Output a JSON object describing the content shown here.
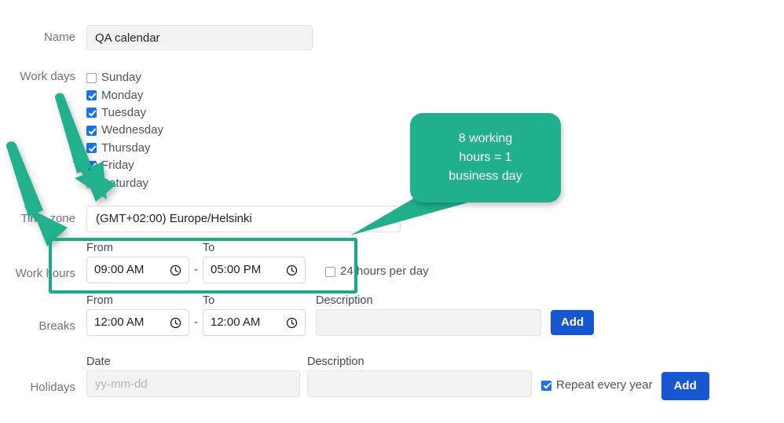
{
  "form": {
    "name": {
      "label": "Name",
      "value": "QA calendar"
    },
    "work_days": {
      "label": "Work days",
      "days": [
        {
          "label": "Sunday",
          "checked": false
        },
        {
          "label": "Monday",
          "checked": true
        },
        {
          "label": "Tuesday",
          "checked": true
        },
        {
          "label": "Wednesday",
          "checked": true
        },
        {
          "label": "Thursday",
          "checked": true
        },
        {
          "label": "Friday",
          "checked": true
        },
        {
          "label": "Saturday",
          "checked": false
        }
      ]
    },
    "time_zone": {
      "label": "Time zone",
      "value": "(GMT+02:00) Europe/Helsinki"
    },
    "work_hours": {
      "label": "Work hours",
      "from_header": "From",
      "to_header": "To",
      "from_value": "09:00 AM",
      "to_value": "05:00 PM",
      "separator": "-",
      "all_day": {
        "label": "24 hours per day",
        "checked": false
      }
    },
    "breaks": {
      "label": "Breaks",
      "from_header": "From",
      "to_header": "To",
      "description_header": "Description",
      "from_value": "12:00 AM",
      "to_value": "12:00 AM",
      "separator": "-",
      "description_value": "",
      "description_placeholder": "",
      "add_label": "Add"
    },
    "holidays": {
      "label": "Holidays",
      "date_header": "Date",
      "description_header": "Description",
      "date_value": "",
      "date_placeholder": "yy-mm-dd",
      "description_value": "",
      "description_placeholder": "",
      "repeat": {
        "label": "Repeat every year",
        "checked": true
      },
      "add_label": "Add"
    }
  },
  "annotations": {
    "callout": {
      "text": "8 working hours = 1 business day",
      "line1": "8 working",
      "line2": "hours = 1",
      "line3": "business day"
    },
    "highlight_label": "work-hours-highlight",
    "arrows": [
      {
        "name": "arrow-upper"
      },
      {
        "name": "arrow-lower"
      }
    ]
  },
  "colors": {
    "accent_green": "#21b08d",
    "highlight_green": "#19ab87",
    "button_blue": "#1756d1",
    "checkbox_blue": "#1a73e8",
    "label_gray": "#6c757d"
  }
}
